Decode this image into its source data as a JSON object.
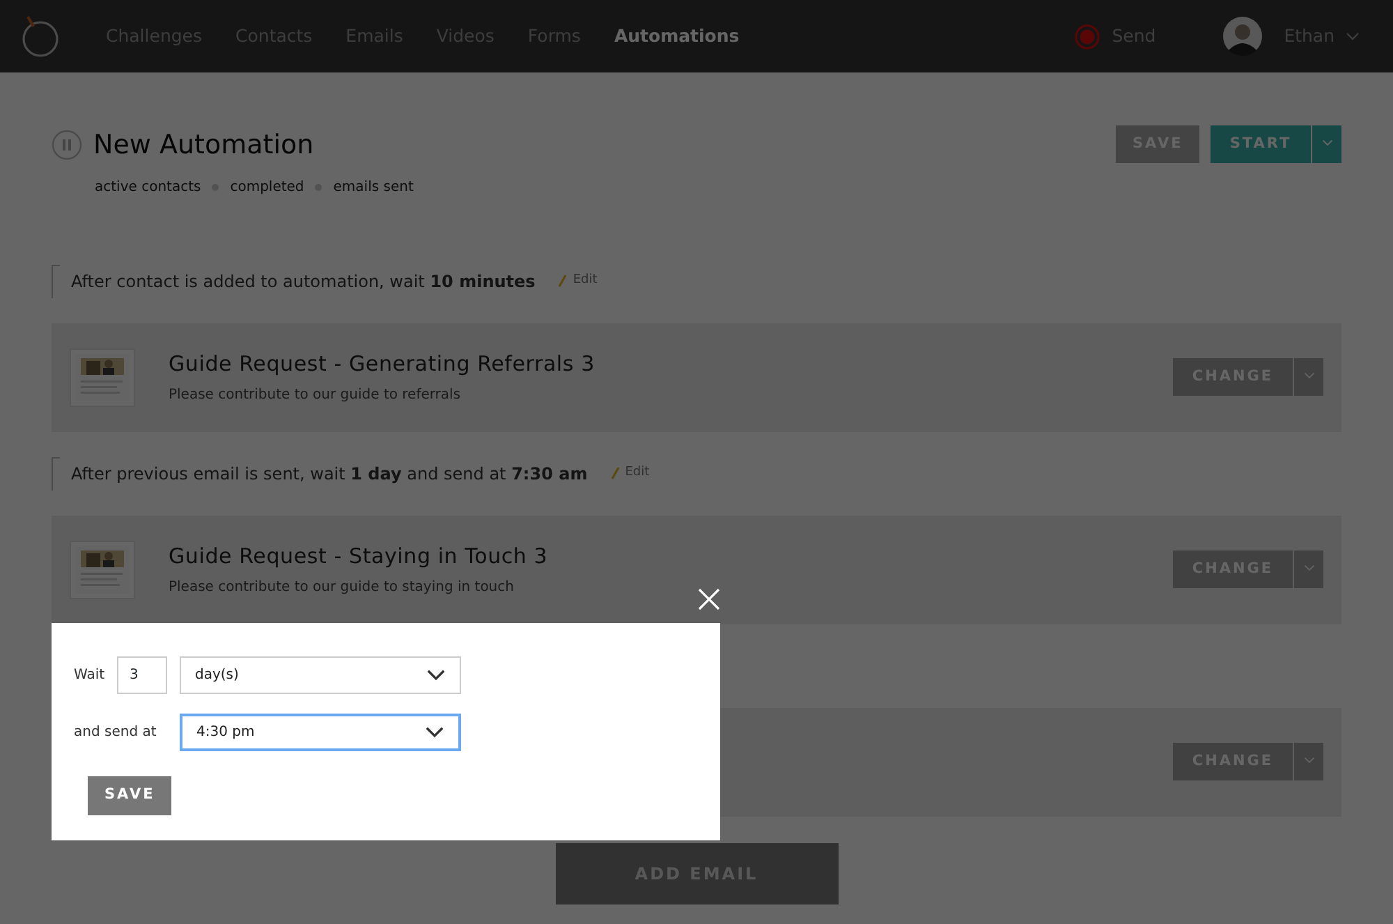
{
  "nav": {
    "items": [
      {
        "label": "Challenges",
        "selected": false
      },
      {
        "label": "Contacts",
        "selected": false
      },
      {
        "label": "Emails",
        "selected": false
      },
      {
        "label": "Videos",
        "selected": false
      },
      {
        "label": "Forms",
        "selected": false
      },
      {
        "label": "Automations",
        "selected": true
      }
    ],
    "send": "Send",
    "user": "Ethan"
  },
  "automation": {
    "title": "New Automation",
    "stats": [
      "active contacts",
      "completed",
      "emails sent"
    ],
    "save": "SAVE",
    "start": "START"
  },
  "steps": [
    {
      "kind": "wait",
      "text": "After contact is added to automation, wait **10 minutes**",
      "edit": "Edit"
    },
    {
      "kind": "email",
      "title": "Guide Request - Generating Referrals 3",
      "subtitle": "Please contribute to our guide to referrals",
      "change": "CHANGE"
    },
    {
      "kind": "wait",
      "text": "After previous email is sent, wait **1 day** and send at **7:30 am**",
      "edit": "Edit"
    },
    {
      "kind": "email",
      "title": "Guide Request - Staying in Touch 3",
      "subtitle": "Please contribute to our guide to staying in touch",
      "change": "CHANGE"
    },
    {
      "kind": "email",
      "change": "CHANGE"
    }
  ],
  "add_button": "ADD EMAIL",
  "modal": {
    "wait_label": "Wait",
    "amount": "3",
    "unit": "day(s)",
    "send_label": "and send at",
    "time": "4:30 pm",
    "time_focused": true,
    "save": "SAVE"
  }
}
